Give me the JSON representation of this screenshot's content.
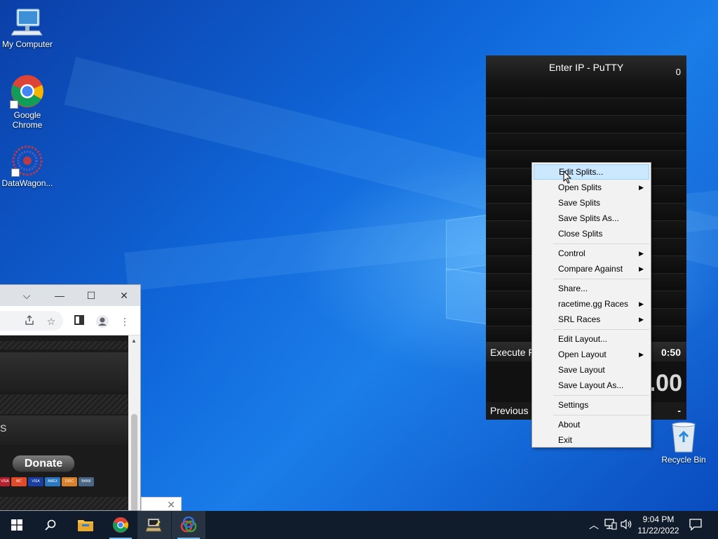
{
  "desktop": {
    "icons": [
      {
        "label": "My Computer",
        "icon": "computer-icon"
      },
      {
        "label": "Google Chrome",
        "icon": "chrome-icon"
      },
      {
        "label": "DataWagon...",
        "icon": "datawagon-icon"
      },
      {
        "label": "Recycle Bin",
        "icon": "recycle-bin-icon"
      }
    ]
  },
  "livesplit": {
    "title": "Enter IP - PuTTY",
    "attempts": "0",
    "current_split_name": "Execute P",
    "current_split_time": "0:50",
    "timer": ".00",
    "previous_label": "Previous S",
    "previous_value": "-"
  },
  "context_menu": {
    "items": [
      {
        "label": "Edit Splits...",
        "submenu": false,
        "highlighted": true
      },
      {
        "label": "Open Splits",
        "submenu": true
      },
      {
        "label": "Save Splits",
        "submenu": false
      },
      {
        "label": "Save Splits As...",
        "submenu": false
      },
      {
        "label": "Close Splits",
        "submenu": false
      },
      {
        "label": "Control",
        "submenu": true
      },
      {
        "label": "Compare Against",
        "submenu": true
      },
      {
        "label": "Share...",
        "submenu": false
      },
      {
        "label": "racetime.gg Races",
        "submenu": true
      },
      {
        "label": "SRL Races",
        "submenu": true
      },
      {
        "label": "Edit Layout...",
        "submenu": false
      },
      {
        "label": "Open Layout",
        "submenu": true
      },
      {
        "label": "Save Layout",
        "submenu": false
      },
      {
        "label": "Save Layout As...",
        "submenu": false
      },
      {
        "label": "Settings",
        "submenu": false
      },
      {
        "label": "About",
        "submenu": false
      },
      {
        "label": "Exit",
        "submenu": false
      }
    ],
    "submenu_arrow": "▶"
  },
  "browser": {
    "page_text_s": "S",
    "donate_label": "Donate",
    "cards": [
      "VISA",
      "MC",
      "VISA",
      "AMEX",
      "DISC",
      "BANK"
    ],
    "window_controls": {
      "dropdown": "⌵",
      "minimize": "—",
      "maximize": "☐",
      "close": "✕"
    },
    "popup_close": "✕"
  },
  "taskbar": {
    "clock_time": "9:04 PM",
    "clock_date": "11/22/2022",
    "apps": [
      "start-button",
      "search-button",
      "file-explorer",
      "google-chrome",
      "putty",
      "livesplit"
    ]
  },
  "colors": {
    "menu_highlight": "#cce8ff",
    "menu_highlight_border": "#99d1ff",
    "taskbar": "#101c2c",
    "accent": "#76b9ed"
  }
}
